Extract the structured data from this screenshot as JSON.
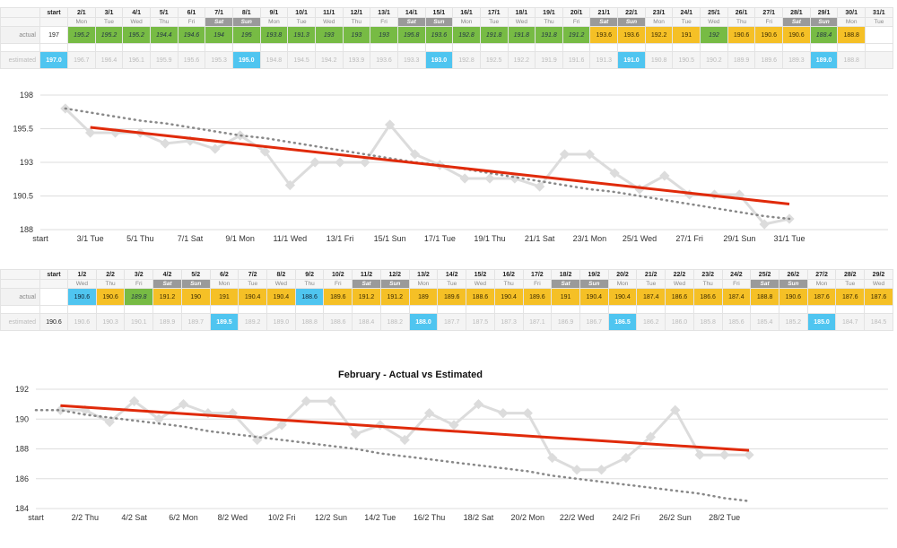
{
  "colors": {
    "green": "#77bb44",
    "yellow": "#f5c026",
    "blue": "#4fc5f0",
    "trend": "#e02a0a",
    "actual_line": "#dcdcdc",
    "estimated_dots": "#888888",
    "grid": "#dddddd"
  },
  "tables": [
    {
      "start_header": "start",
      "row_labels": {
        "actual": "actual",
        "estimated": "estimated"
      },
      "start_actual": "197",
      "start_estimated": "197.0",
      "dates": [
        "2/1",
        "3/1",
        "4/1",
        "5/1",
        "6/1",
        "7/1",
        "8/1",
        "9/1",
        "10/1",
        "11/1",
        "12/1",
        "13/1",
        "14/1",
        "15/1",
        "16/1",
        "17/1",
        "18/1",
        "19/1",
        "20/1",
        "21/1",
        "22/1",
        "23/1",
        "24/1",
        "25/1",
        "26/1",
        "27/1",
        "28/1",
        "29/1",
        "30/1",
        "31/1"
      ],
      "days": [
        "Mon",
        "Tue",
        "Wed",
        "Thu",
        "Fri",
        "Sat",
        "Sun",
        "Mon",
        "Tue",
        "Wed",
        "Thu",
        "Fri",
        "Sat",
        "Sun",
        "Mon",
        "Tue",
        "Wed",
        "Thu",
        "Fri",
        "Sat",
        "Sun",
        "Mon",
        "Tue",
        "Wed",
        "Thu",
        "Fri",
        "Sat",
        "Sun",
        "Mon",
        "Tue"
      ],
      "actual": [
        "195.2",
        "195.2",
        "195.2",
        "194.4",
        "194.6",
        "194",
        "195",
        "193.8",
        "191.3",
        "193",
        "193",
        "193",
        "195.8",
        "193.6",
        "192.8",
        "191.8",
        "191.8",
        "191.8",
        "191.2",
        "193.6",
        "193.6",
        "192.2",
        "191",
        "192",
        "190.6",
        "190.6",
        "190.6",
        "188.4",
        "188.8",
        ""
      ],
      "actual_colors": [
        "g",
        "g",
        "g",
        "g",
        "g",
        "g",
        "g",
        "g",
        "g",
        "g",
        "g",
        "g",
        "g",
        "g",
        "g",
        "g",
        "g",
        "g",
        "g",
        "y",
        "y",
        "y",
        "y",
        "g",
        "y",
        "y",
        "y",
        "g",
        "y",
        ""
      ],
      "estimated": [
        "196.7",
        "196.4",
        "196.1",
        "195.9",
        "195.6",
        "195.3",
        "195.0",
        "194.8",
        "194.5",
        "194.2",
        "193.9",
        "193.6",
        "193.3",
        "193.0",
        "192.8",
        "192.5",
        "192.2",
        "191.9",
        "191.6",
        "191.3",
        "191.0",
        "190.8",
        "190.5",
        "190.2",
        "189.9",
        "189.6",
        "189.3",
        "189.0",
        "188.8",
        ""
      ],
      "est_highlight": [
        false,
        false,
        false,
        false,
        false,
        false,
        true,
        false,
        false,
        false,
        false,
        false,
        false,
        true,
        false,
        false,
        false,
        false,
        false,
        false,
        true,
        false,
        false,
        false,
        false,
        false,
        false,
        true,
        false,
        false
      ]
    },
    {
      "start_header": "start",
      "row_labels": {
        "actual": "actual",
        "estimated": "estimated"
      },
      "start_actual": "",
      "start_estimated": "190.6",
      "dates": [
        "1/2",
        "2/2",
        "3/2",
        "4/2",
        "5/2",
        "6/2",
        "7/2",
        "8/2",
        "9/2",
        "10/2",
        "11/2",
        "12/2",
        "13/2",
        "14/2",
        "15/2",
        "16/2",
        "17/2",
        "18/2",
        "19/2",
        "20/2",
        "21/2",
        "22/2",
        "23/2",
        "24/2",
        "25/2",
        "26/2",
        "27/2",
        "28/2",
        "29/2"
      ],
      "days": [
        "Wed",
        "Thu",
        "Fri",
        "Sat",
        "Sun",
        "Mon",
        "Tue",
        "Wed",
        "Thu",
        "Fri",
        "Sat",
        "Sun",
        "Mon",
        "Tue",
        "Wed",
        "Thu",
        "Fri",
        "Sat",
        "Sun",
        "Mon",
        "Tue",
        "Wed",
        "Thu",
        "Fri",
        "Sat",
        "Sun",
        "Mon",
        "Tue",
        "Wed"
      ],
      "actual": [
        "190.6",
        "190.6",
        "189.8",
        "191.2",
        "190",
        "191",
        "190.4",
        "190.4",
        "188.6",
        "189.6",
        "191.2",
        "191.2",
        "189",
        "189.6",
        "188.6",
        "190.4",
        "189.6",
        "191",
        "190.4",
        "190.4",
        "187.4",
        "186.6",
        "186.6",
        "187.4",
        "188.8",
        "190.6",
        "187.6",
        "187.6",
        "187.6"
      ],
      "actual_colors": [
        "b",
        "y",
        "g",
        "y",
        "y",
        "y",
        "y",
        "y",
        "b",
        "y",
        "y",
        "y",
        "y",
        "y",
        "y",
        "y",
        "y",
        "y",
        "y",
        "y",
        "y",
        "y",
        "y",
        "y",
        "y",
        "y",
        "y",
        "y",
        "y"
      ],
      "estimated": [
        "190.6",
        "190.3",
        "190.1",
        "189.9",
        "189.7",
        "189.5",
        "189.2",
        "189.0",
        "188.8",
        "188.6",
        "188.4",
        "188.2",
        "188.0",
        "187.7",
        "187.5",
        "187.3",
        "187.1",
        "186.9",
        "186.7",
        "186.5",
        "186.2",
        "186.0",
        "185.8",
        "185.6",
        "185.4",
        "185.2",
        "185.0",
        "184.7",
        "184.5"
      ],
      "est_highlight": [
        false,
        false,
        false,
        false,
        false,
        true,
        false,
        false,
        false,
        false,
        false,
        false,
        true,
        false,
        false,
        false,
        false,
        false,
        false,
        true,
        false,
        false,
        false,
        false,
        false,
        false,
        true,
        false,
        false
      ]
    }
  ],
  "chart_data": [
    {
      "type": "line",
      "title": "",
      "x": [
        "start",
        "2/1",
        "3/1",
        "4/1",
        "5/1",
        "6/1",
        "7/1",
        "8/1",
        "9/1",
        "10/1",
        "11/1",
        "12/1",
        "13/1",
        "14/1",
        "15/1",
        "16/1",
        "17/1",
        "18/1",
        "19/1",
        "20/1",
        "21/1",
        "22/1",
        "23/1",
        "24/1",
        "25/1",
        "26/1",
        "27/1",
        "28/1",
        "29/1",
        "30/1",
        "31/1"
      ],
      "tick_labels": [
        "start",
        "3/1 Tue",
        "5/1 Thu",
        "7/1 Sat",
        "9/1 Mon",
        "11/1 Wed",
        "13/1 Fri",
        "15/1 Sun",
        "17/1 Tue",
        "19/1 Thu",
        "21/1 Sat",
        "23/1 Mon",
        "25/1 Wed",
        "27/1 Fri",
        "29/1 Sun",
        "31/1 Tue"
      ],
      "y_ticks": [
        "198",
        "195.5",
        "193",
        "190.5",
        "188"
      ],
      "ylim": [
        188,
        198
      ],
      "grid": true,
      "series": [
        {
          "role": "actual",
          "values": [
            null,
            197,
            195.2,
            195.2,
            195.2,
            194.4,
            194.6,
            194,
            195,
            193.8,
            191.3,
            193,
            193,
            193,
            195.8,
            193.6,
            192.8,
            191.8,
            191.8,
            191.8,
            191.2,
            193.6,
            193.6,
            192.2,
            191,
            192,
            190.6,
            190.6,
            190.6,
            188.4,
            188.8
          ]
        },
        {
          "role": "estimated",
          "values": [
            null,
            197,
            196.7,
            196.4,
            196.1,
            195.9,
            195.6,
            195.3,
            195,
            194.8,
            194.5,
            194.2,
            193.9,
            193.6,
            193.3,
            193,
            192.8,
            192.5,
            192.2,
            191.9,
            191.6,
            191.3,
            191,
            190.8,
            190.5,
            190.2,
            189.9,
            189.6,
            189.3,
            189,
            188.8
          ]
        },
        {
          "role": "trend",
          "from": [
            2,
            195.6
          ],
          "to": [
            30,
            189.9
          ]
        }
      ]
    },
    {
      "type": "line",
      "title": "February - Actual vs Estimated",
      "x": [
        "start",
        "1/2",
        "2/2",
        "3/2",
        "4/2",
        "5/2",
        "6/2",
        "7/2",
        "8/2",
        "9/2",
        "10/2",
        "11/2",
        "12/2",
        "13/2",
        "14/2",
        "15/2",
        "16/2",
        "17/2",
        "18/2",
        "19/2",
        "20/2",
        "21/2",
        "22/2",
        "23/2",
        "24/2",
        "25/2",
        "26/2",
        "27/2",
        "28/2",
        "29/2"
      ],
      "tick_labels": [
        "start",
        "2/2 Thu",
        "4/2 Sat",
        "6/2 Mon",
        "8/2 Wed",
        "10/2 Fri",
        "12/2 Sun",
        "14/2 Tue",
        "16/2 Thu",
        "18/2 Sat",
        "20/2 Mon",
        "22/2 Wed",
        "24/2 Fri",
        "26/2 Sun",
        "28/2 Tue"
      ],
      "y_ticks": [
        "192",
        "190",
        "188",
        "186",
        "184"
      ],
      "ylim": [
        184,
        192
      ],
      "grid": true,
      "series": [
        {
          "role": "actual",
          "values": [
            null,
            190.6,
            190.6,
            189.8,
            191.2,
            190,
            191,
            190.4,
            190.4,
            188.6,
            189.6,
            191.2,
            191.2,
            189,
            189.6,
            188.6,
            190.4,
            189.6,
            191,
            190.4,
            190.4,
            187.4,
            186.6,
            186.6,
            187.4,
            188.8,
            190.6,
            187.6,
            187.6,
            187.6
          ]
        },
        {
          "role": "estimated",
          "values": [
            190.6,
            190.6,
            190.3,
            190.1,
            189.9,
            189.7,
            189.5,
            189.2,
            189,
            188.8,
            188.6,
            188.4,
            188.2,
            188,
            187.7,
            187.5,
            187.3,
            187.1,
            186.9,
            186.7,
            186.5,
            186.2,
            186,
            185.8,
            185.6,
            185.4,
            185.2,
            185,
            184.7,
            184.5
          ]
        },
        {
          "role": "trend",
          "from": [
            1,
            190.9
          ],
          "to": [
            29,
            187.9
          ]
        }
      ]
    }
  ]
}
